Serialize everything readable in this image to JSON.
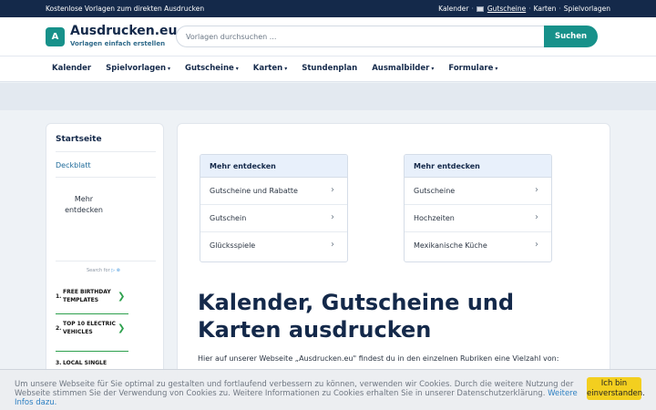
{
  "topbar": {
    "left_text": "Kostenlose Vorlagen zum direkten Ausdrucken",
    "links": [
      "Kalender",
      "Gutscheine",
      "Karten",
      "Spielvorlagen"
    ],
    "separator": "·"
  },
  "header": {
    "logo_letter": "A",
    "site_name": "Ausdrucken.eu",
    "tagline": "Vorlagen einfach erstellen",
    "search_placeholder": "Vorlagen durchsuchen ...",
    "search_button": "Suchen",
    "brand_color": "#17918a",
    "navy_color": "#14294a"
  },
  "nav": {
    "items": [
      {
        "label": "Kalender",
        "dropdown": false
      },
      {
        "label": "Spielvorlagen",
        "dropdown": true
      },
      {
        "label": "Gutscheine",
        "dropdown": true
      },
      {
        "label": "Karten",
        "dropdown": true
      },
      {
        "label": "Stundenplan",
        "dropdown": false
      },
      {
        "label": "Ausmalbilder",
        "dropdown": true
      },
      {
        "label": "Formulare",
        "dropdown": true
      }
    ],
    "caret": "▾"
  },
  "sidebar": {
    "title": "Startseite",
    "link": "Deckblatt",
    "more_label": "Mehr entdecken",
    "search_for": "Search for",
    "ad_items": [
      {
        "num": "1.",
        "text": "FREE BIRTHDAY TEMPLATES"
      },
      {
        "num": "2.",
        "text": "TOP 10 ELECTRIC VEHICLES"
      },
      {
        "num": "3.",
        "text": "LOCAL SINGLE"
      }
    ],
    "ad_arrow": "❯"
  },
  "main": {
    "cards": [
      {
        "title": "Mehr entdecken",
        "rows": [
          "Gutscheine und Rabatte",
          "Gutschein",
          "Glücksspiele"
        ]
      },
      {
        "title": "Mehr entdecken",
        "rows": [
          "Gutscheine",
          "Hochzeiten",
          "Mexikanische Küche"
        ]
      }
    ],
    "chevron": "›",
    "headline": "Kalender, Gutscheine und Karten ausdrucken",
    "intro": "Hier auf unserer Webseite „Ausdrucken.eu\" findest du in den einzelnen Rubriken eine Vielzahl von:"
  },
  "cookie": {
    "text": "Um unsere Webseite für Sie optimal zu gestalten und fortlaufend verbessern zu können, verwenden wir Cookies. Durch die weitere Nutzung der Webseite stimmen Sie der Verwendung von Cookies zu. Weitere Informationen zu Cookies erhalten Sie in unserer Datenschutzerklärung.",
    "link": "Weitere Infos dazu.",
    "button": "Ich bin einverstanden."
  }
}
